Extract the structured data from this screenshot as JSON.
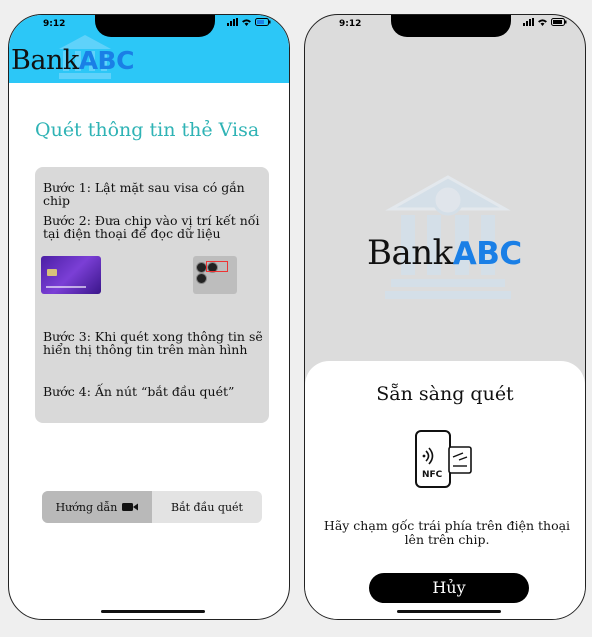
{
  "status_bar": {
    "time": "9:12"
  },
  "screen_guide": {
    "logo": {
      "word": "Bank",
      "accent": "ABC"
    },
    "title": "Quét thông tin thẻ Visa",
    "steps": [
      "Bước 1:  Lật mặt sau visa có gắn chip",
      "Bước 2: Đưa chip vào vị trí kết nối tại điện thoại để đọc dữ liệu",
      "Bước 3:  Khi quét xong thông tin sẽ hiển thị thông tin trên màn hình",
      "Bước 4:  Ấn nút “bắt đầu quét”"
    ],
    "tabs": {
      "guide": "Hướng dẫn",
      "start": "Bắt đầu quét"
    }
  },
  "screen_scan": {
    "logo": {
      "word": "Bank",
      "accent": "ABC"
    },
    "sheet": {
      "title": "Sẵn sàng quét",
      "nfc_label": "NFC",
      "instruction": "Hãy chạm gốc trái phía trên điện thoại lên trên chip.",
      "cancel": "Hủy"
    }
  },
  "colors": {
    "header": "#2cc7f7",
    "accent": "#1a7fe6",
    "title": "#2fb3b5",
    "card": "#5a27b8"
  }
}
